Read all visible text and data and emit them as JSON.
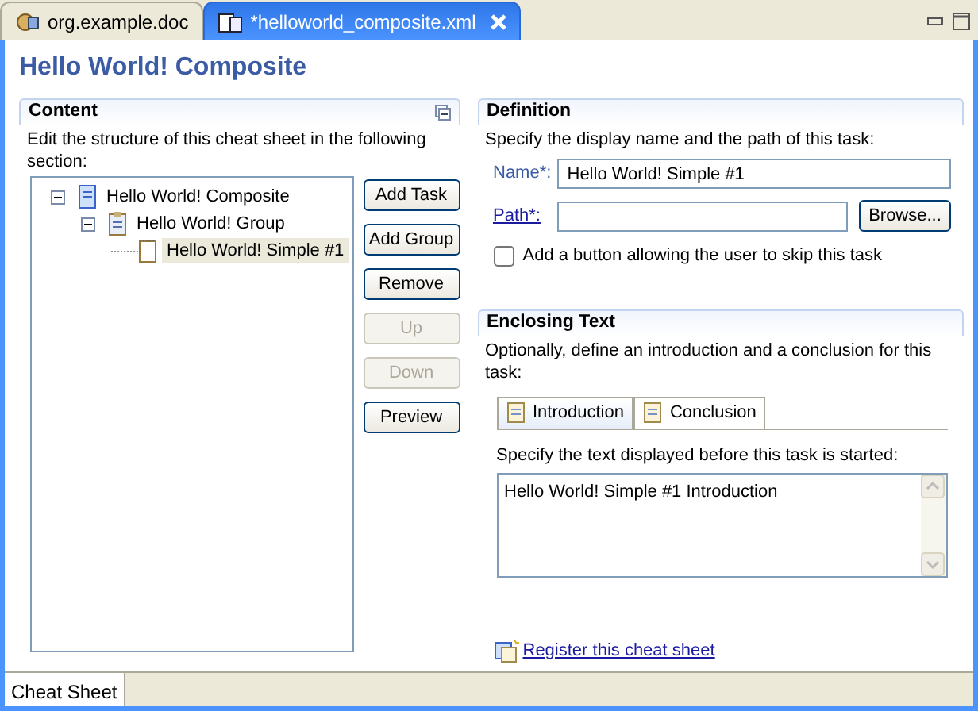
{
  "editor_tabs": [
    {
      "label": "org.example.doc",
      "selected": false
    },
    {
      "label": "*helloworld_composite.xml",
      "selected": true
    }
  ],
  "title": "Hello World! Composite",
  "content": {
    "title": "Content",
    "description": "Edit the structure of this cheat sheet in the following section:",
    "tree": [
      {
        "label": "Hello World! Composite",
        "kind": "composite",
        "expanded": true,
        "selected": false,
        "children": [
          {
            "label": "Hello World! Group",
            "kind": "group",
            "expanded": true,
            "selected": false,
            "children": [
              {
                "label": "Hello World! Simple #1",
                "kind": "task",
                "selected": true
              }
            ]
          }
        ]
      }
    ],
    "buttons": [
      {
        "label": "Add Task",
        "disabled": false
      },
      {
        "label": "Add Group",
        "disabled": false
      },
      {
        "label": "Remove",
        "disabled": false
      },
      {
        "label": "Up",
        "disabled": true
      },
      {
        "label": "Down",
        "disabled": true
      },
      {
        "label": "Preview",
        "disabled": false
      }
    ]
  },
  "definition": {
    "title": "Definition",
    "description": "Specify the display name and the path of this task:",
    "fields": [
      {
        "label": "Name*:",
        "kind": "label",
        "value": "Hello World! Simple #1"
      },
      {
        "label": "Path*:",
        "kind": "link",
        "button": "Browse..."
      }
    ],
    "checkbox": {
      "label": "Add a button allowing the user to skip this task",
      "checked": false
    }
  },
  "enclosing_text": {
    "title": "Enclosing Text",
    "description": "Optionally, define an introduction and a conclusion for this task:",
    "tabs": [
      {
        "label": "Introduction",
        "selected": true
      },
      {
        "label": "Conclusion",
        "selected": false
      }
    ],
    "prompt": "Specify the text displayed before this task is started:",
    "text": "Hello World! Simple #1 Introduction"
  },
  "register_link": "Register this cheat sheet",
  "bottom_tabs": [
    {
      "label": "Cheat Sheet",
      "selected": true
    }
  ]
}
